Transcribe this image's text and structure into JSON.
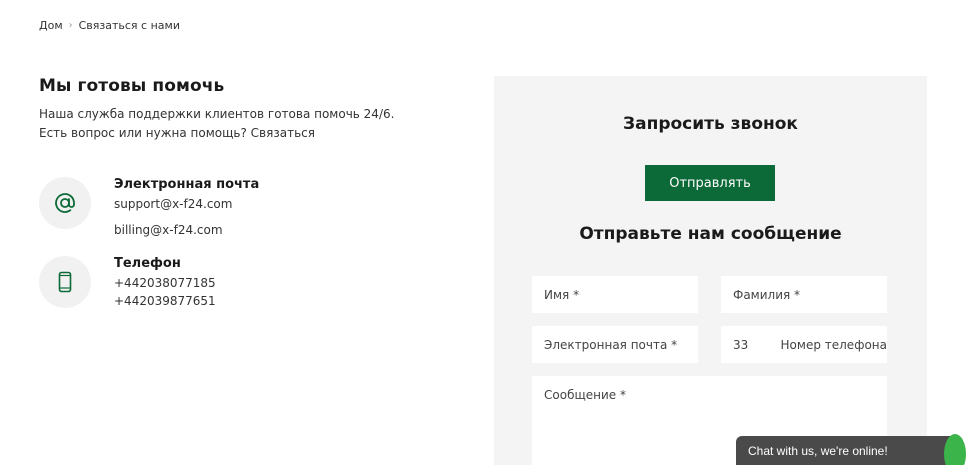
{
  "breadcrumb": {
    "home": "Дом",
    "separator": "›",
    "current": "Связаться с нами"
  },
  "intro": {
    "title": "Мы готовы помочь",
    "line1": "Наша служба поддержки клиентов готова помочь 24/6.",
    "line2": "Есть вопрос или нужна помощь? Связаться"
  },
  "email_block": {
    "title": "Электронная почта",
    "support": "support@x-f24.com",
    "billing": "billing@x-f24.com",
    "icon": "at-icon"
  },
  "phone_block": {
    "title": "Телефон",
    "phone1": "+442038077185",
    "phone2": "+442039877651",
    "icon": "mobile-phone-icon"
  },
  "callback": {
    "title": "Запросить звонок",
    "button": "Отправлять"
  },
  "message_form": {
    "title": "Отправьте нам сообщение",
    "first_name": "Имя *",
    "last_name": "Фамилия *",
    "email": "Электронная почта *",
    "phone_code": "33",
    "phone": "Номер телефона",
    "message": "Сообщение *"
  },
  "chat": {
    "label": "Chat with us, we're online!"
  },
  "colors": {
    "accent": "#0c6a38",
    "panel": "#f4f4f4",
    "chat": "#4a4a4a",
    "online": "#3bb44a"
  }
}
